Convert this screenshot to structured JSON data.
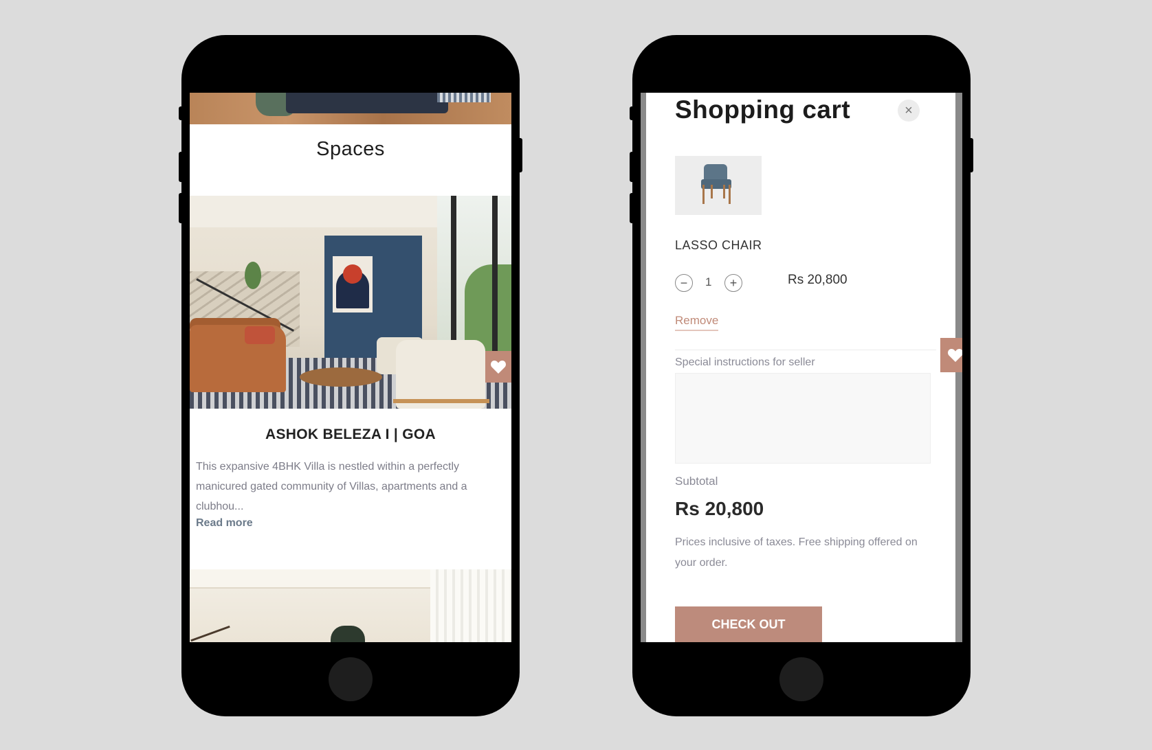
{
  "left_screen": {
    "section_title": "Spaces",
    "project": {
      "title": "ASHOK BELEZA I | GOA",
      "description": "This expansive 4BHK Villa is nestled within a perfectly manicured gated community of Villas, apartments and a clubhou...",
      "read_more": "Read more"
    }
  },
  "right_screen": {
    "title": "Shopping cart",
    "close_symbol": "×",
    "item": {
      "name": "LASSO CHAIR",
      "quantity": "1",
      "decrement_symbol": "−",
      "increment_symbol": "+",
      "price": "Rs 20,800",
      "remove_label": "Remove"
    },
    "instructions_label": "Special instructions for seller",
    "subtotal_label": "Subtotal",
    "subtotal_value": "Rs 20,800",
    "tax_note": "Prices inclusive of taxes. Free shipping offered on your order.",
    "checkout_label": "CHECK OUT"
  },
  "colors": {
    "accent": "#c08a78",
    "background": "#dcdcdc",
    "phone_body": "#000000"
  },
  "icons": [
    "heart-icon",
    "close-icon",
    "minus-icon",
    "plus-icon",
    "chair-thumbnail"
  ]
}
